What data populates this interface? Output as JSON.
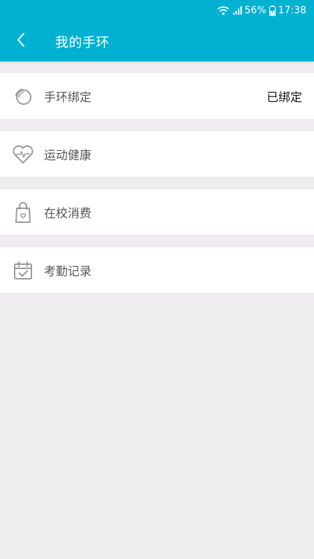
{
  "status_bar": {
    "battery_percent": "56%",
    "time": "17:38"
  },
  "header": {
    "title": "我的手环",
    "back_icon": "chevron-left-icon"
  },
  "menu": {
    "items": [
      {
        "label": "手环绑定",
        "value": "已绑定",
        "icon": "band-icon"
      },
      {
        "label": "运动健康",
        "icon": "heartbeat-icon"
      },
      {
        "label": "在校消费",
        "icon": "shopping-bag-icon"
      },
      {
        "label": "考勤记录",
        "icon": "calendar-check-icon"
      }
    ]
  },
  "colors": {
    "accent": "#00b1d1",
    "background": "#efedf0",
    "icon_gray": "#9a9a9a"
  }
}
